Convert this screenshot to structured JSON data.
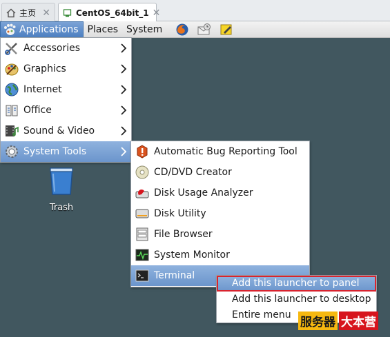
{
  "tabs": [
    {
      "label": "主页",
      "icon": "home-icon"
    },
    {
      "label": "CentOS_64bit_1",
      "icon": "vm-icon"
    }
  ],
  "panel": {
    "menus": [
      "Applications",
      "Places",
      "System"
    ],
    "launchers": [
      "firefox-icon",
      "mail-icon",
      "notes-icon"
    ]
  },
  "app_menu": [
    {
      "label": "Accessories",
      "icon": "accessories-icon"
    },
    {
      "label": "Graphics",
      "icon": "graphics-icon"
    },
    {
      "label": "Internet",
      "icon": "internet-icon"
    },
    {
      "label": "Office",
      "icon": "office-icon"
    },
    {
      "label": "Sound & Video",
      "icon": "sound-video-icon"
    },
    {
      "label": "System Tools",
      "icon": "system-tools-icon",
      "selected": true
    }
  ],
  "system_tools_menu": [
    {
      "label": "Automatic Bug Reporting Tool",
      "icon": "bug-report-icon"
    },
    {
      "label": "CD/DVD Creator",
      "icon": "cd-dvd-icon"
    },
    {
      "label": "Disk Usage Analyzer",
      "icon": "disk-usage-icon"
    },
    {
      "label": "Disk Utility",
      "icon": "disk-utility-icon"
    },
    {
      "label": "File Browser",
      "icon": "file-browser-icon"
    },
    {
      "label": "System Monitor",
      "icon": "system-monitor-icon"
    },
    {
      "label": "Terminal",
      "icon": "terminal-icon",
      "selected": true
    }
  ],
  "context_menu": [
    {
      "label": "Add this launcher to panel",
      "selected": true
    },
    {
      "label": "Add this launcher to desktop"
    },
    {
      "label": "Entire menu"
    }
  ],
  "desktop": {
    "trash_label": "Trash"
  },
  "watermark": [
    "服务器",
    "大本营"
  ],
  "colors": {
    "desktop": "#41575f",
    "selection": "#6b95cc",
    "highlight_box": "#d9232e"
  }
}
